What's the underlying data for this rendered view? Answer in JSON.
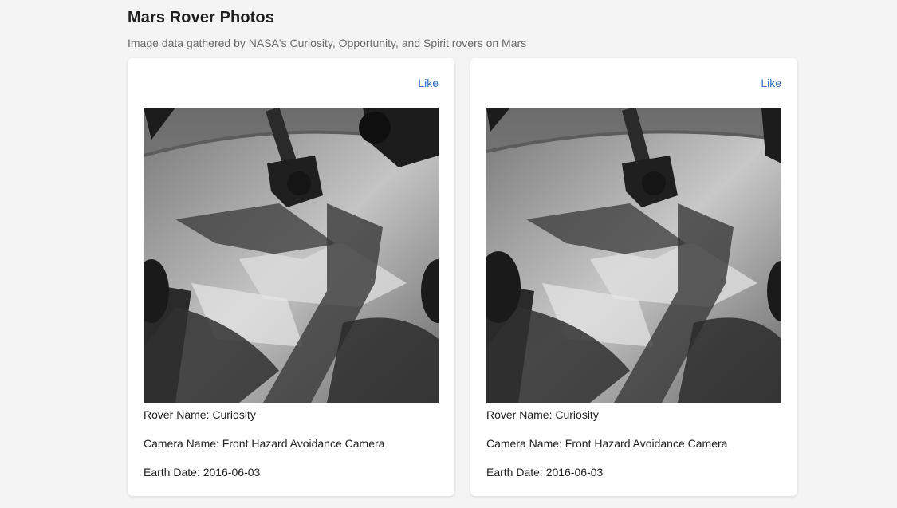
{
  "header": {
    "title": "Mars Rover Photos",
    "subtitle": "Image data gathered by NASA's Curiosity, Opportunity, and Spirit rovers on Mars"
  },
  "cards": [
    {
      "like_label": "Like",
      "rover": "Rover Name: Curiosity",
      "camera": "Camera Name: Front Hazard Avoidance Camera",
      "date": "Earth Date: 2016-06-03"
    },
    {
      "like_label": "Like",
      "rover": "Rover Name: Curiosity",
      "camera": "Camera Name: Front Hazard Avoidance Camera",
      "date": "Earth Date: 2016-06-03"
    }
  ]
}
